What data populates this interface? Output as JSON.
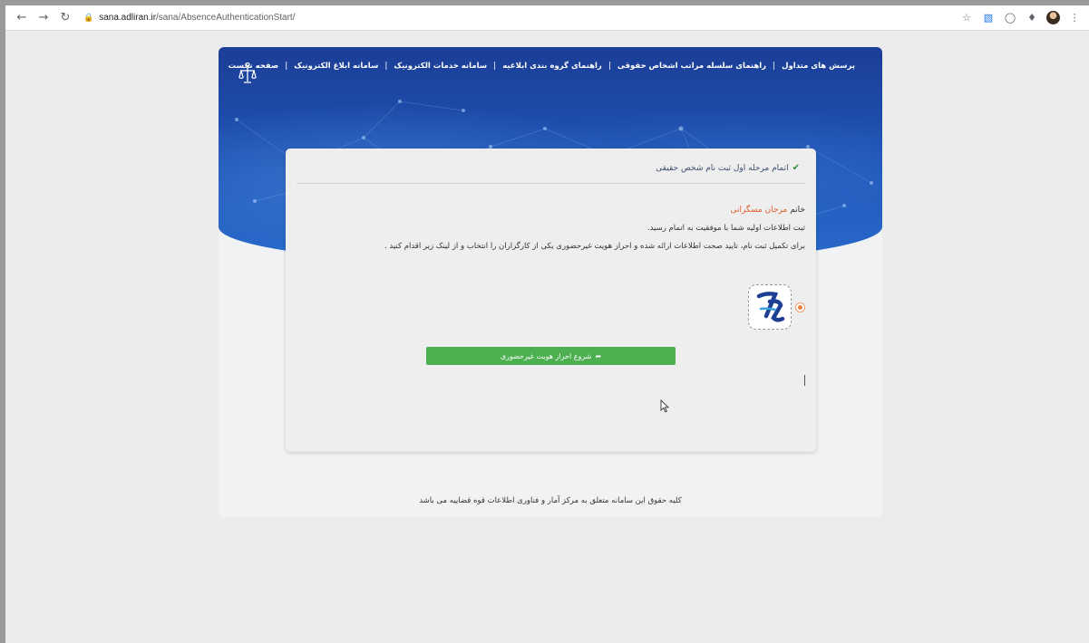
{
  "browser": {
    "url_host": "sana.adliran.ir",
    "url_path": "/sana/AbsenceAuthenticationStart/"
  },
  "nav": {
    "items": [
      "صفحه نخست",
      "سامانه ابلاغ الکترونیک",
      "سامانه خدمات الکترونیک",
      "راهنمای گروه بندی ابلاغیه",
      "راهنمای سلسله مراتب اشخاص حقوقی",
      "پرسش های متداول"
    ],
    "separator": "|"
  },
  "card": {
    "header": "اتمام مرحله اول ثبت نام شخص حقیقی",
    "salutation": "خانم",
    "user_name": "مرجان مسگرانی",
    "success_message": "ثبت اطلاعات اولیه شما با موفقیت به اتمام رسید.",
    "instruction": "برای تکمیل ثبت نام، تایید صحت اطلاعات ارائه شده و احراز هویت غیرحضوری یکی از کارگزاران را انتخاب و از لینک زیر اقدام کنید .",
    "start_button": "شروع احراز هویت غیرحضوری"
  },
  "footer": {
    "text": "کلیه حقوق این سامانه متعلق به مرکز آمار و فناوری اطلاعات قوه قضاییه می باشد"
  },
  "colors": {
    "hero": "#1e55b8",
    "button": "#4caf50",
    "name_highlight": "#e05a2b",
    "check": "#2e8b3a"
  }
}
